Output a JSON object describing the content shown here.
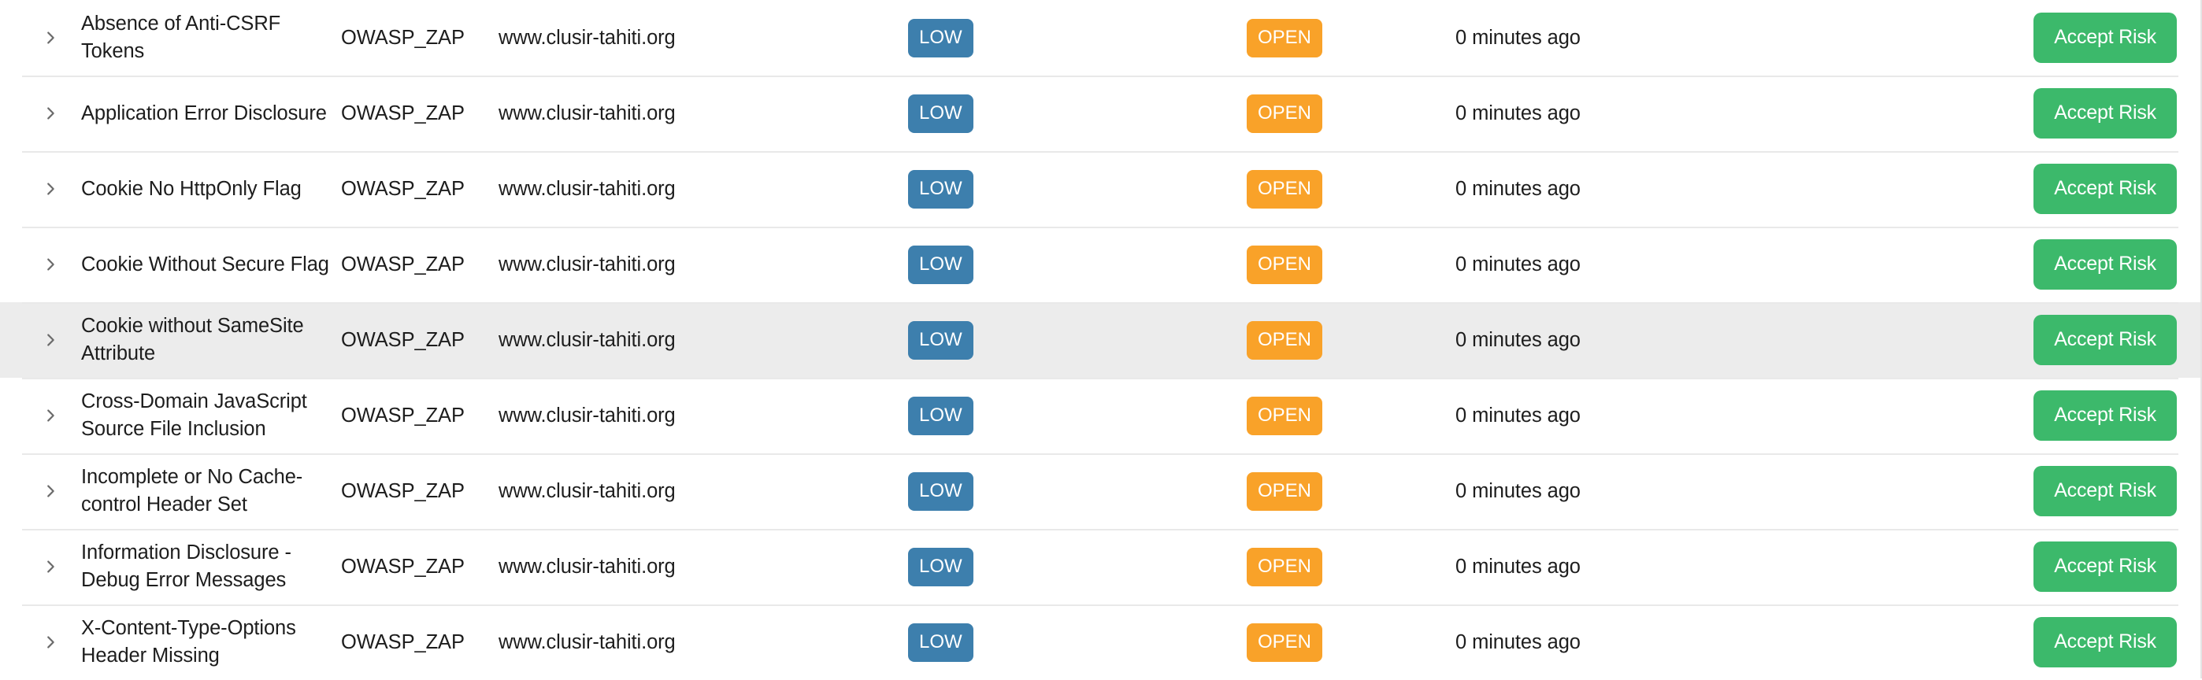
{
  "table": {
    "name": "security-findings-table",
    "columns": [
      "expand",
      "title",
      "scanner",
      "url",
      "severity",
      "status",
      "discovered",
      "action"
    ],
    "accent_colors": {
      "severity_low": "#3d7fad",
      "status_open": "#f9a229",
      "accept_risk_button": "#3cb96b",
      "row_highlight": "#ececec",
      "row_divider": "#e9e9e9",
      "text": "#1d1d1d",
      "chevron": "#6b6b6b"
    },
    "expand_icon": "chevron-right-icon",
    "rows": [
      {
        "title": "Absence of Anti-CSRF Tokens",
        "scanner": "OWASP_ZAP",
        "url": "www.clusir-tahiti.org",
        "severity": "LOW",
        "status": "OPEN",
        "discovered": "0 minutes ago",
        "action_label": "Accept Risk",
        "highlighted": false
      },
      {
        "title": "Application Error Disclosure",
        "scanner": "OWASP_ZAP",
        "url": "www.clusir-tahiti.org",
        "severity": "LOW",
        "status": "OPEN",
        "discovered": "0 minutes ago",
        "action_label": "Accept Risk",
        "highlighted": false
      },
      {
        "title": "Cookie No HttpOnly Flag",
        "scanner": "OWASP_ZAP",
        "url": "www.clusir-tahiti.org",
        "severity": "LOW",
        "status": "OPEN",
        "discovered": "0 minutes ago",
        "action_label": "Accept Risk",
        "highlighted": false
      },
      {
        "title": "Cookie Without Secure Flag",
        "scanner": "OWASP_ZAP",
        "url": "www.clusir-tahiti.org",
        "severity": "LOW",
        "status": "OPEN",
        "discovered": "0 minutes ago",
        "action_label": "Accept Risk",
        "highlighted": false
      },
      {
        "title": "Cookie without SameSite Attribute",
        "scanner": "OWASP_ZAP",
        "url": "www.clusir-tahiti.org",
        "severity": "LOW",
        "status": "OPEN",
        "discovered": "0 minutes ago",
        "action_label": "Accept Risk",
        "highlighted": true
      },
      {
        "title": "Cross-Domain JavaScript Source File Inclusion",
        "scanner": "OWASP_ZAP",
        "url": "www.clusir-tahiti.org",
        "severity": "LOW",
        "status": "OPEN",
        "discovered": "0 minutes ago",
        "action_label": "Accept Risk",
        "highlighted": false
      },
      {
        "title": "Incomplete or No Cache-control Header Set",
        "scanner": "OWASP_ZAP",
        "url": "www.clusir-tahiti.org",
        "severity": "LOW",
        "status": "OPEN",
        "discovered": "0 minutes ago",
        "action_label": "Accept Risk",
        "highlighted": false
      },
      {
        "title": "Information Disclosure - Debug Error Messages",
        "scanner": "OWASP_ZAP",
        "url": "www.clusir-tahiti.org",
        "severity": "LOW",
        "status": "OPEN",
        "discovered": "0 minutes ago",
        "action_label": "Accept Risk",
        "highlighted": false
      },
      {
        "title": "X-Content-Type-Options Header Missing",
        "scanner": "OWASP_ZAP",
        "url": "www.clusir-tahiti.org",
        "severity": "LOW",
        "status": "OPEN",
        "discovered": "0 minutes ago",
        "action_label": "Accept Risk",
        "highlighted": false
      }
    ]
  }
}
